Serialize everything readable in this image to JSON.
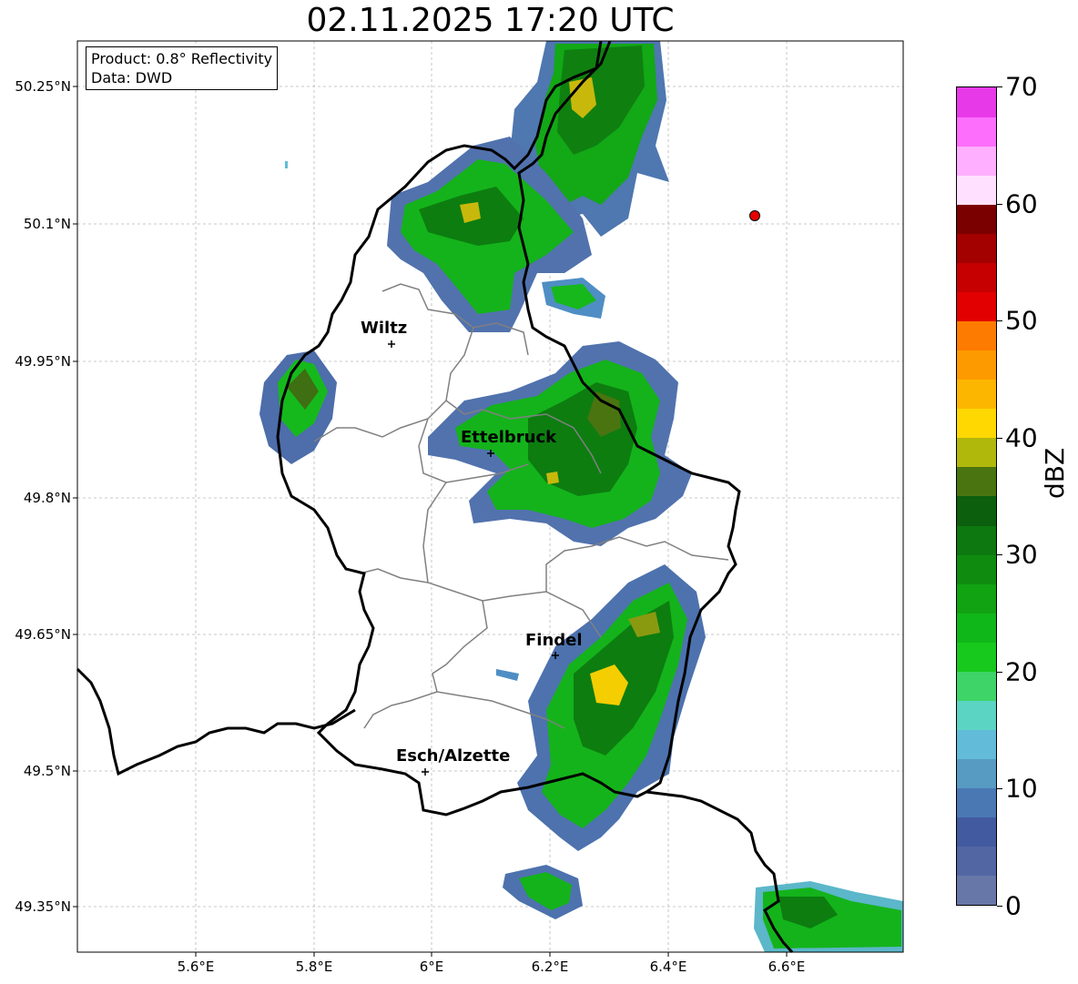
{
  "title": "02.11.2025 17:20 UTC",
  "info": {
    "product": "Product: 0.8° Reflectivity",
    "source": "Data: DWD"
  },
  "axes": {
    "lat_ticks": [
      "50.25°N",
      "50.1°N",
      "49.95°N",
      "49.8°N",
      "49.65°N",
      "49.5°N",
      "49.35°N"
    ],
    "lon_ticks": [
      "5.6°E",
      "5.8°E",
      "6°E",
      "6.2°E",
      "6.4°E",
      "6.6°E"
    ]
  },
  "cities": [
    {
      "name": "Wiltz"
    },
    {
      "name": "Ettelbruck"
    },
    {
      "name": "Findel"
    },
    {
      "name": "Esch/Alzette"
    }
  ],
  "colorbar": {
    "label": "dBZ",
    "ticks": [
      "0",
      "10",
      "20",
      "30",
      "40",
      "50",
      "60",
      "70"
    ],
    "colors": [
      "#6778a8",
      "#5266a3",
      "#425aa0",
      "#4a78b3",
      "#579ac2",
      "#62bcd9",
      "#5cd4c3",
      "#3ed468",
      "#17c91d",
      "#10b718",
      "#11a311",
      "#0f8c10",
      "#0d780f",
      "#0c5f0c",
      "#4a7410",
      "#b1b80c",
      "#fed800",
      "#fdb600",
      "#fd9a00",
      "#fd7b00",
      "#e20000",
      "#c60000",
      "#a30000",
      "#7a0000",
      "#ffe0fe",
      "#ffafff",
      "#fd6efd",
      "#e839e9"
    ]
  },
  "radar_site_color": "#e60000"
}
